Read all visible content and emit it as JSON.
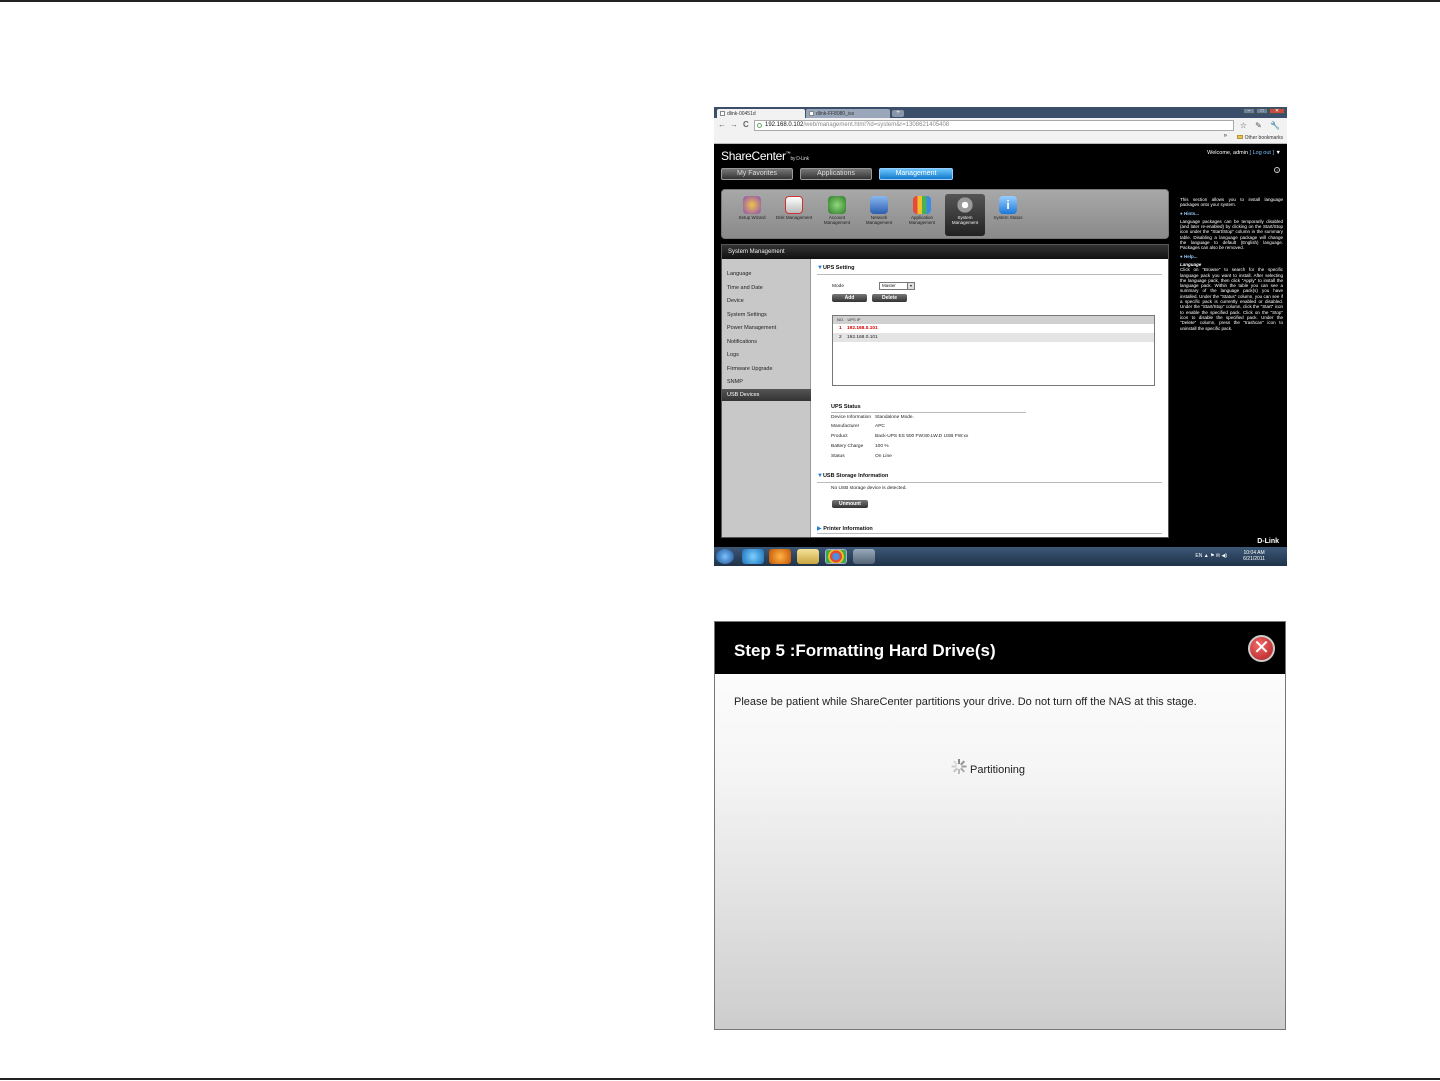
{
  "browser": {
    "tabs": [
      {
        "label": "dlink-00451d"
      },
      {
        "label": "dlink-FF8080_isx"
      }
    ],
    "new_tab": "+",
    "window_buttons": [
      "–",
      "□",
      "✕"
    ],
    "nav": {
      "back": "←",
      "forward": "→",
      "reload": "C"
    },
    "url_host": "192.168.0.102",
    "url_rest": "/web/management.html?id=system&r=1308621405408",
    "url_icons": "☆ ✎ 🔧",
    "bookmarks_more": "»",
    "other_bookmarks": "Other bookmarks"
  },
  "app": {
    "brand": "ShareCenter",
    "brand_tm": "™",
    "brand_by": "by D-Link",
    "welcome_prefix": "Welcome, admin ",
    "logout": "[ Log out ]",
    "logout_arrow": " ▼",
    "help": "?",
    "main_tabs": [
      {
        "label": "My Favorites"
      },
      {
        "label": "Applications"
      },
      {
        "label": "Management"
      }
    ],
    "active_tab": "Management",
    "icons": [
      {
        "label": "Setup Wizard",
        "color": "#8a4fb8"
      },
      {
        "label": "Disk Management",
        "color": "#d9d9d9"
      },
      {
        "label": "Account Management",
        "color": "#5aa04a"
      },
      {
        "label": "Network Management",
        "color": "#4a7fd0"
      },
      {
        "label": "Application Management",
        "color": "#e8a030"
      },
      {
        "label": "System Management",
        "color": "#c0c0c0"
      },
      {
        "label": "System Status",
        "color": "#3aa0e8"
      }
    ],
    "selected_icon": "System Management",
    "panel_title": "System Management",
    "left_menu": [
      "Language",
      "Time and Date",
      "Device",
      "System Settings",
      "Power Management",
      "Notifications",
      "Logs",
      "Firmware Upgrade",
      "SNMP",
      "USB Devices"
    ],
    "selected_menu": "USB Devices",
    "ups_setting": {
      "title": "UPS Setting",
      "mode_label": "Mode",
      "mode_value": "Master",
      "add": "Add",
      "delete": "Delete",
      "columns": [
        "NO.",
        "UPS IP"
      ],
      "rows": [
        {
          "no": "1",
          "ip": "192.168.0.101"
        },
        {
          "no": "2",
          "ip": "192.168.0.101"
        }
      ]
    },
    "ups_status": {
      "title": "UPS Status",
      "fields": [
        {
          "label": "Device Information",
          "value": "Standalone Mode."
        },
        {
          "label": "Manufacturer",
          "value": "APC"
        },
        {
          "label": "Product",
          "value": "Back-UPS ES 500 FW:80.LW.D USB FW:xx"
        },
        {
          "label": "Battery Charge",
          "value": "100 %"
        },
        {
          "label": "Status",
          "value": "On Line"
        }
      ]
    },
    "usb_storage": {
      "title": "USB Storage Information",
      "message": "No USB storage device is detected.",
      "unmount": "Unmount"
    },
    "printer": {
      "title": "Printer Information"
    },
    "sidebar": {
      "intro": "This section allows you to install language packages onto your system.",
      "hints_title": "Hints...",
      "hints_text": "Language packages can be temporarily disabled (and later re-enabled) by clicking on the Start/Stop icon under the \"Start/Stop\" column in the summary table. Disabling a language package will change the language to default (English) language. Packages can also be removed.",
      "help_title": "Help...",
      "help_sub": "Language",
      "help_text": "Click on \"Browse\" to search for the specific language pack you want to install. After selecting the language pack, then click \"Apply\" to install the language pack. Within the table you can see a summary of the language pack(s) you have installed. Under the \"Status\" column, you can see if a specific pack is currently enabled or disabled. Under the \"Start/Stop\" column, click the \"Start\" icon to enable the specified pack. Click on the \"Stop\" icon to disable the specified pack. Under the \"Delete\" column, press the \"trashcan\" icon to uninstall the specific pack."
    },
    "footer_brand": "D-Link"
  },
  "taskbar": {
    "items": [
      "start",
      "ie",
      "firefox",
      "explorer",
      "chrome",
      "network"
    ],
    "tray": "EN ▲ ⚑ ✉ ◀)",
    "time": "10:04 AM",
    "date": "6/21/2011"
  },
  "dialog": {
    "title": "Step 5 :Formatting Hard Drive(s)",
    "close": "✕",
    "message": "Please be patient while ShareCenter partitions your drive. Do not turn off the NAS at this stage.",
    "status": "Partitioning"
  }
}
